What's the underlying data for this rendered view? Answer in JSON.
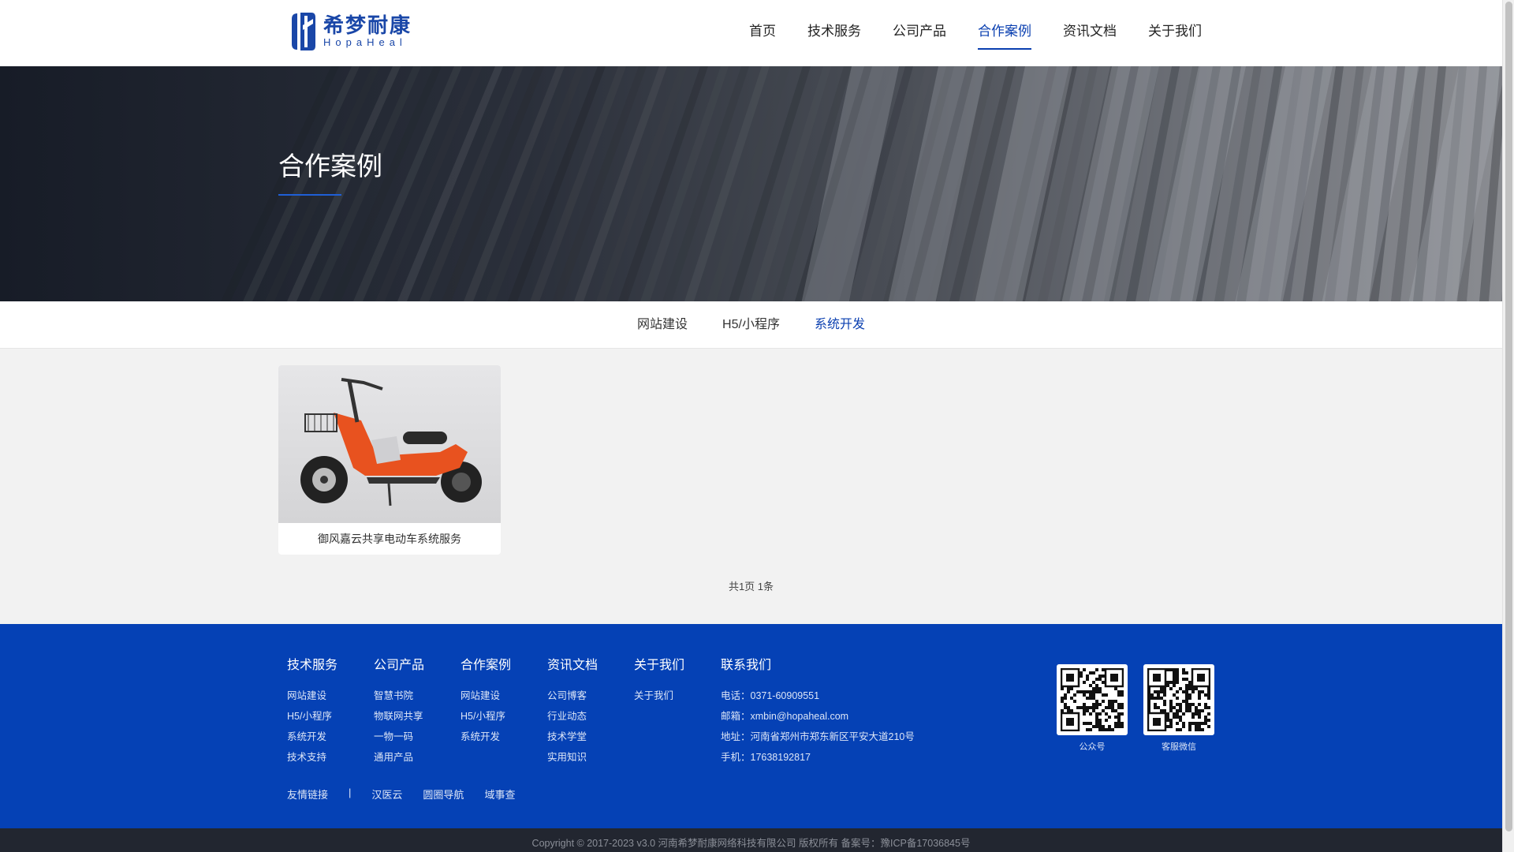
{
  "logo": {
    "cn": "希梦耐康",
    "en": "HopaHeal"
  },
  "nav": [
    {
      "label": "首页",
      "active": false
    },
    {
      "label": "技术服务",
      "active": false
    },
    {
      "label": "公司产品",
      "active": false
    },
    {
      "label": "合作案例",
      "active": true
    },
    {
      "label": "资讯文档",
      "active": false
    },
    {
      "label": "关于我们",
      "active": false
    }
  ],
  "banner": {
    "title": "合作案例"
  },
  "subtabs": [
    {
      "label": "网站建设",
      "active": false
    },
    {
      "label": "H5/小程序",
      "active": false
    },
    {
      "label": "系统开发",
      "active": true
    }
  ],
  "cases": [
    {
      "title": "御风嘉云共享电动车系统服务"
    }
  ],
  "pager": "共1页 1条",
  "footer": {
    "columns": [
      {
        "title": "技术服务",
        "links": [
          "网站建设",
          "H5/小程序",
          "系统开发",
          "技术支持"
        ]
      },
      {
        "title": "公司产品",
        "links": [
          "智慧书院",
          "物联网共享",
          "一物一码",
          "通用产品"
        ]
      },
      {
        "title": "合作案例",
        "links": [
          "网站建设",
          "H5/小程序",
          "系统开发"
        ]
      },
      {
        "title": "资讯文档",
        "links": [
          "公司博客",
          "行业动态",
          "技术学堂",
          "实用知识"
        ]
      },
      {
        "title": "关于我们",
        "links": [
          "关于我们"
        ]
      }
    ],
    "contact": {
      "title": "联系我们",
      "phone": "电话：0371-60909551",
      "email": "邮箱：xmbin@hopaheal.com",
      "address": "地址：河南省郑州市郑东新区平安大道210号",
      "mobile": "手机：17638192817"
    },
    "qr": [
      {
        "label": "公众号"
      },
      {
        "label": "客服微信"
      }
    ],
    "friend_title": "友情链接",
    "friend_sep": "|",
    "friend_links": [
      "汉医云",
      "圆圈导航",
      "域事查"
    ],
    "copyright": "Copyright © 2017-2023 v3.0 河南希梦耐康网络科技有限公司 版权所有   备案号：豫ICP备17036845号"
  },
  "colors": {
    "brand": "#0a3fb0",
    "footer_bg": "#0541b5"
  }
}
